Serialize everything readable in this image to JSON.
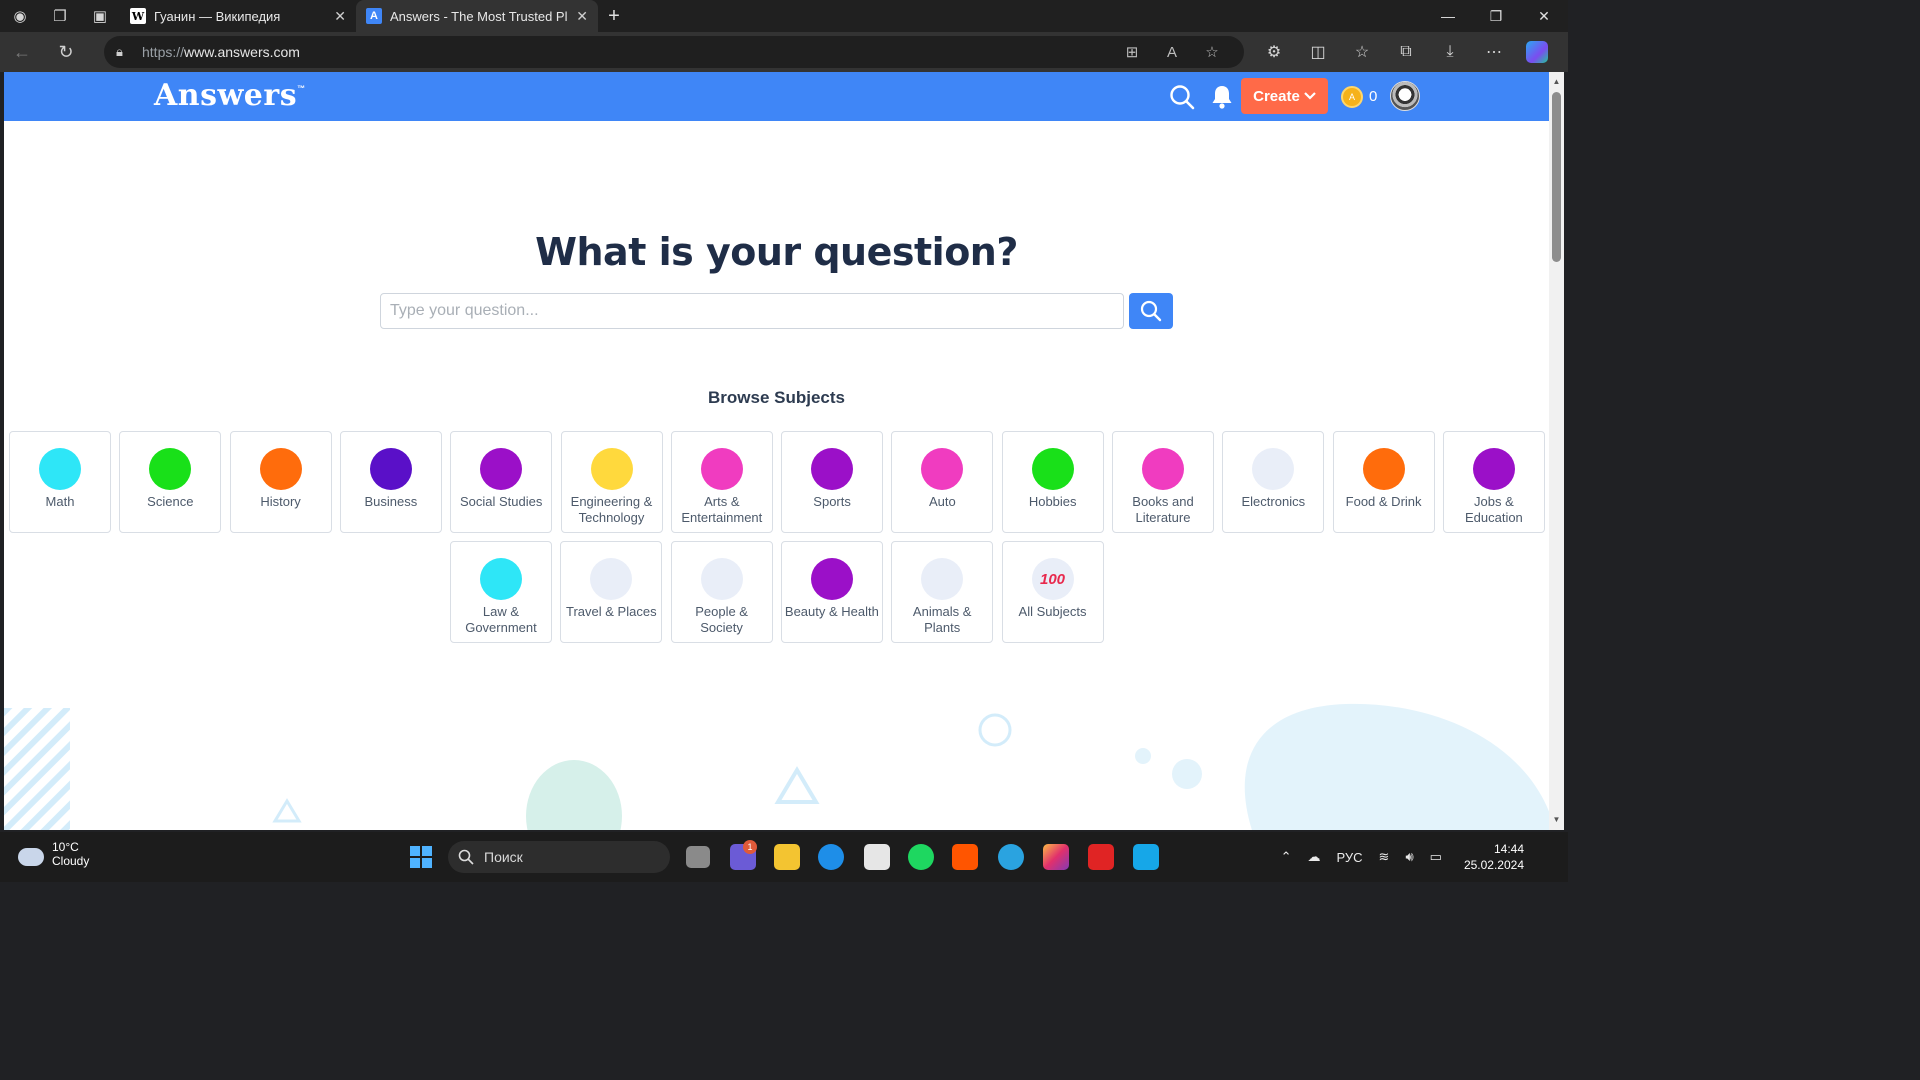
{
  "browser": {
    "tabs": [
      {
        "title": "Гуанин — Википедия",
        "favicon": "W",
        "active": false
      },
      {
        "title": "Answers - The Most Trusted Place",
        "favicon": "A",
        "active": true
      }
    ],
    "url_prefix": "https://",
    "url_host": "www.answers.com"
  },
  "site": {
    "logo": "Answers",
    "logo_tm": "™",
    "create_label": "Create",
    "coin_count": "0",
    "brand_color": "#3f86f7",
    "create_color": "#ff6a48"
  },
  "main": {
    "title": "What is your question?",
    "search_placeholder": "Type your question...",
    "browse_title": "Browse Subjects",
    "subjects": [
      {
        "label": "Math",
        "color": "#2ee6f7"
      },
      {
        "label": "Science",
        "color": "#19e019"
      },
      {
        "label": "History",
        "color": "#ff6c0c"
      },
      {
        "label": "Business",
        "color": "#5a10c8"
      },
      {
        "label": "Social Studies",
        "color": "#9b10c8"
      },
      {
        "label": "Engineering & Technology",
        "color": "#ffd93d"
      },
      {
        "label": "Arts & Entertainment",
        "color": "#f03cc0"
      },
      {
        "label": "Sports",
        "color": "#9b10c8"
      },
      {
        "label": "Auto",
        "color": "#f03cc0"
      },
      {
        "label": "Hobbies",
        "color": "#19e019"
      },
      {
        "label": "Books and Literature",
        "color": "#f03cc0"
      },
      {
        "label": "Electronics",
        "color": "#e9eef8"
      },
      {
        "label": "Food & Drink",
        "color": "#ff6c0c"
      },
      {
        "label": "Jobs & Education",
        "color": "#9b10c8"
      },
      {
        "label": "Law & Government",
        "color": "#2ee6f7"
      },
      {
        "label": "Travel & Places",
        "color": "#e9eef8"
      },
      {
        "label": "People & Society",
        "color": "#e9eef8"
      },
      {
        "label": "Beauty & Health",
        "color": "#9b10c8"
      },
      {
        "label": "Animals & Plants",
        "color": "#e9eef8"
      },
      {
        "label": "All Subjects",
        "color": "#e9eef8",
        "icon": "100"
      }
    ]
  },
  "taskbar": {
    "weather_temp": "10°C",
    "weather_desc": "Cloudy",
    "search_label": "Поиск",
    "lang": "РУС",
    "time": "14:44",
    "date": "25.02.2024",
    "teams_badge": "1"
  }
}
